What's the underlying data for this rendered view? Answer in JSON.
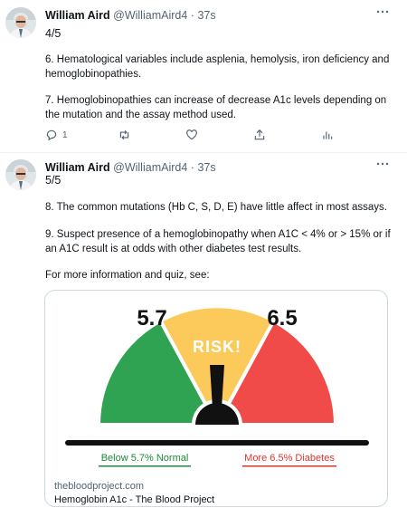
{
  "tweets": [
    {
      "author_name": "William Aird",
      "author_handle": "@WilliamAird4",
      "separator": "·",
      "time": "37s",
      "counter": "4/5",
      "paragraphs": [
        "6. Hematological variables include asplenia, hemolysis, iron deficiency and hemoglobinopathies.",
        "7. Hemoglobinopathies can increase of decrease A1c levels depending on the mutation and the assay method used."
      ],
      "actions": {
        "reply_count": "1"
      }
    },
    {
      "author_name": "William Aird",
      "author_handle": "@WilliamAird4",
      "separator": "·",
      "time": "37s",
      "counter": "5/5",
      "paragraphs": [
        "8. The common mutations (Hb C, S, D, E) have little affect in most assays.",
        "9. Suspect presence of a hemoglobinopathy when A1C < 4% or > 15% or if an A1C result is at odds with other diabetes test results.",
        "For more information and quiz, see:"
      ]
    }
  ],
  "card": {
    "image": {
      "left_value": "5.7",
      "right_value": "6.5",
      "risk_label": "RISK!",
      "left_caption": "Below 5.7% Normal",
      "right_caption": "More 6.5% Diabetes",
      "colors": {
        "green": "#2fa351",
        "yellow": "#fcca5a",
        "red": "#f04b48",
        "risk_text": "#ffffff",
        "left_caption": "#1b8a3b",
        "right_caption": "#e0342f"
      }
    },
    "domain": "thebloodproject.com",
    "title": "Hemoglobin A1c - The Blood Project"
  },
  "icons": {
    "more": "more-icon",
    "reply": "reply-icon",
    "retweet": "retweet-icon",
    "like": "like-icon",
    "share": "share-icon",
    "analytics": "analytics-icon"
  }
}
